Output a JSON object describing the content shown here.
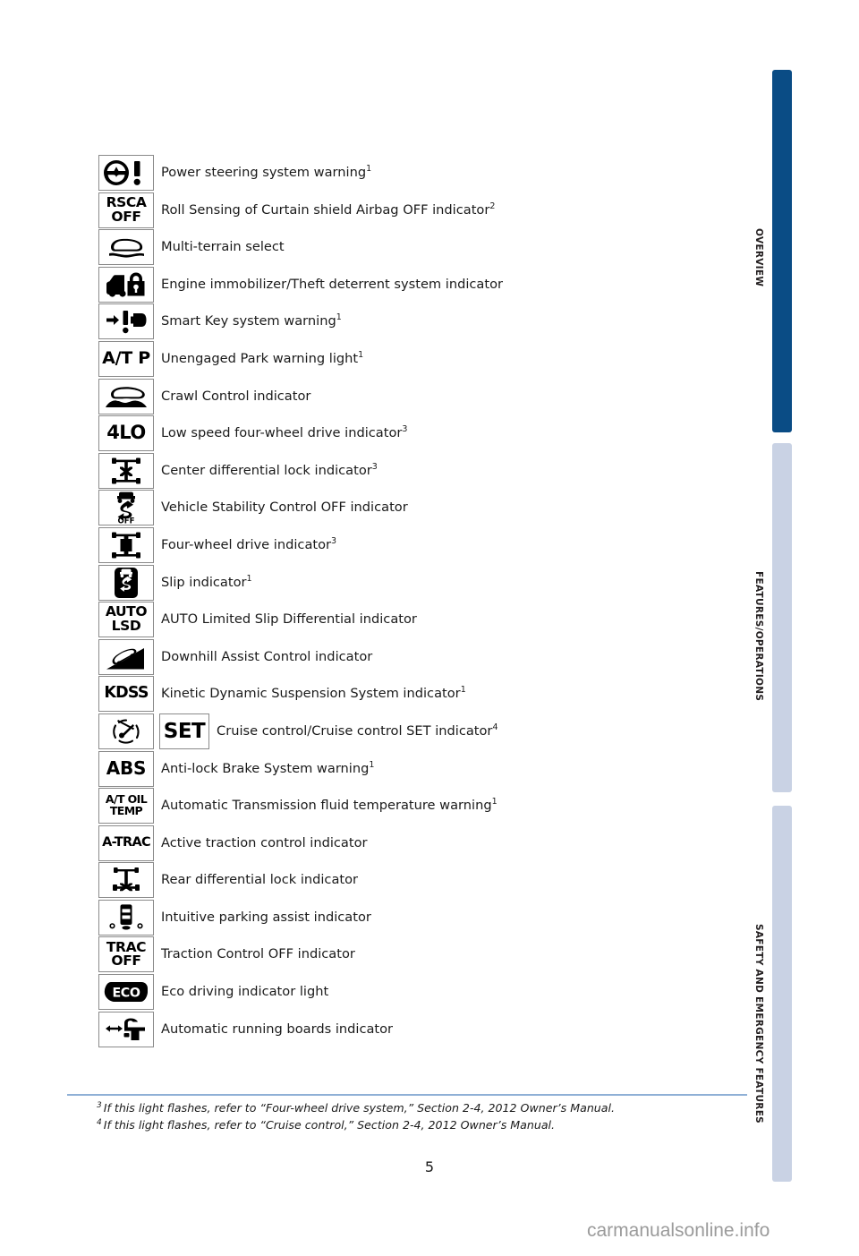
{
  "document": {
    "page_number": "5",
    "watermark": "carmanualsonline.info"
  },
  "side_tabs": [
    {
      "label": "OVERVIEW",
      "state": "active",
      "color": "#0a4c85"
    },
    {
      "label": "FEATURES/OPERATIONS",
      "state": "inactive",
      "color": "#c9d2e4"
    },
    {
      "label": "SAFETY AND EMERGENCY FEATURES",
      "state": "inactive",
      "color": "#c9d2e4"
    }
  ],
  "indicators": [
    {
      "icon": "steering-wheel-exclamation-icon",
      "label": "Power steering system warning",
      "footnote": "1"
    },
    {
      "icon": "rsca-off-text-icon",
      "icon_text": "RSCA OFF",
      "label": "Roll Sensing of Curtain shield Airbag OFF indicator",
      "footnote": "2"
    },
    {
      "icon": "multi-terrain-select-icon",
      "label": "Multi-terrain select",
      "footnote": ""
    },
    {
      "icon": "engine-immobilizer-icon",
      "label": "Engine immobilizer/Theft deterrent system indicator",
      "footnote": ""
    },
    {
      "icon": "smart-key-warning-icon",
      "label": "Smart Key system warning",
      "footnote": "1"
    },
    {
      "icon": "at-p-text-icon",
      "icon_text": "A/T P",
      "label": "Unengaged Park warning light",
      "footnote": "1"
    },
    {
      "icon": "crawl-control-icon",
      "label": "Crawl Control indicator",
      "footnote": ""
    },
    {
      "icon": "four-lo-text-icon",
      "icon_text": "4LO",
      "label": "Low speed four-wheel drive indicator",
      "footnote": "3"
    },
    {
      "icon": "center-differential-lock-icon",
      "label": "Center differential lock indicator",
      "footnote": "3"
    },
    {
      "icon": "vehicle-stability-control-off-icon",
      "icon_text": "OFF",
      "label": "Vehicle Stability Control OFF indicator",
      "footnote": ""
    },
    {
      "icon": "four-wheel-drive-icon",
      "label": "Four-wheel drive indicator",
      "footnote": "3"
    },
    {
      "icon": "slip-indicator-icon",
      "label": "Slip indicator",
      "footnote": "1"
    },
    {
      "icon": "auto-lsd-text-icon",
      "icon_text": "AUTO LSD",
      "label": "AUTO Limited Slip Differential indicator",
      "footnote": ""
    },
    {
      "icon": "downhill-assist-control-icon",
      "label": "Downhill Assist Control indicator",
      "footnote": ""
    },
    {
      "icon": "kdss-text-icon",
      "icon_text": "KDSS",
      "label": "Kinetic Dynamic Suspension System indicator",
      "footnote": "1"
    },
    {
      "icon": "cruise-control-icon",
      "extra_icon": "set-text-icon",
      "extra_icon_text": "SET",
      "label": "Cruise control/Cruise control SET indicator",
      "footnote": "4"
    },
    {
      "icon": "abs-text-icon",
      "icon_text": "ABS",
      "label": "Anti-lock Brake System warning",
      "footnote": "1"
    },
    {
      "icon": "at-oil-temp-text-icon",
      "icon_text": "A/T OIL TEMP",
      "label": "Automatic Transmission fluid temperature warning",
      "footnote": "1"
    },
    {
      "icon": "a-trac-text-icon",
      "icon_text": "A-TRAC",
      "label": "Active traction control indicator",
      "footnote": ""
    },
    {
      "icon": "rear-differential-lock-icon",
      "label": "Rear differential lock indicator",
      "footnote": ""
    },
    {
      "icon": "intuitive-parking-assist-icon",
      "label": "Intuitive parking assist indicator",
      "footnote": ""
    },
    {
      "icon": "trac-off-text-icon",
      "icon_text": "TRAC OFF",
      "label": "Traction Control OFF indicator",
      "footnote": ""
    },
    {
      "icon": "eco-text-icon",
      "icon_text": "ECO",
      "label": "Eco driving indicator light",
      "footnote": ""
    },
    {
      "icon": "automatic-running-boards-icon",
      "label": "Automatic running boards indicator",
      "footnote": ""
    }
  ],
  "footnotes": [
    {
      "marker": "3",
      "text": "If this light flashes, refer to “Four-wheel drive system,” Section 2-4, 2012 Owner’s Manual."
    },
    {
      "marker": "4",
      "text": "If this light flashes, refer to “Cruise control,” Section 2-4, 2012 Owner’s Manual."
    }
  ]
}
